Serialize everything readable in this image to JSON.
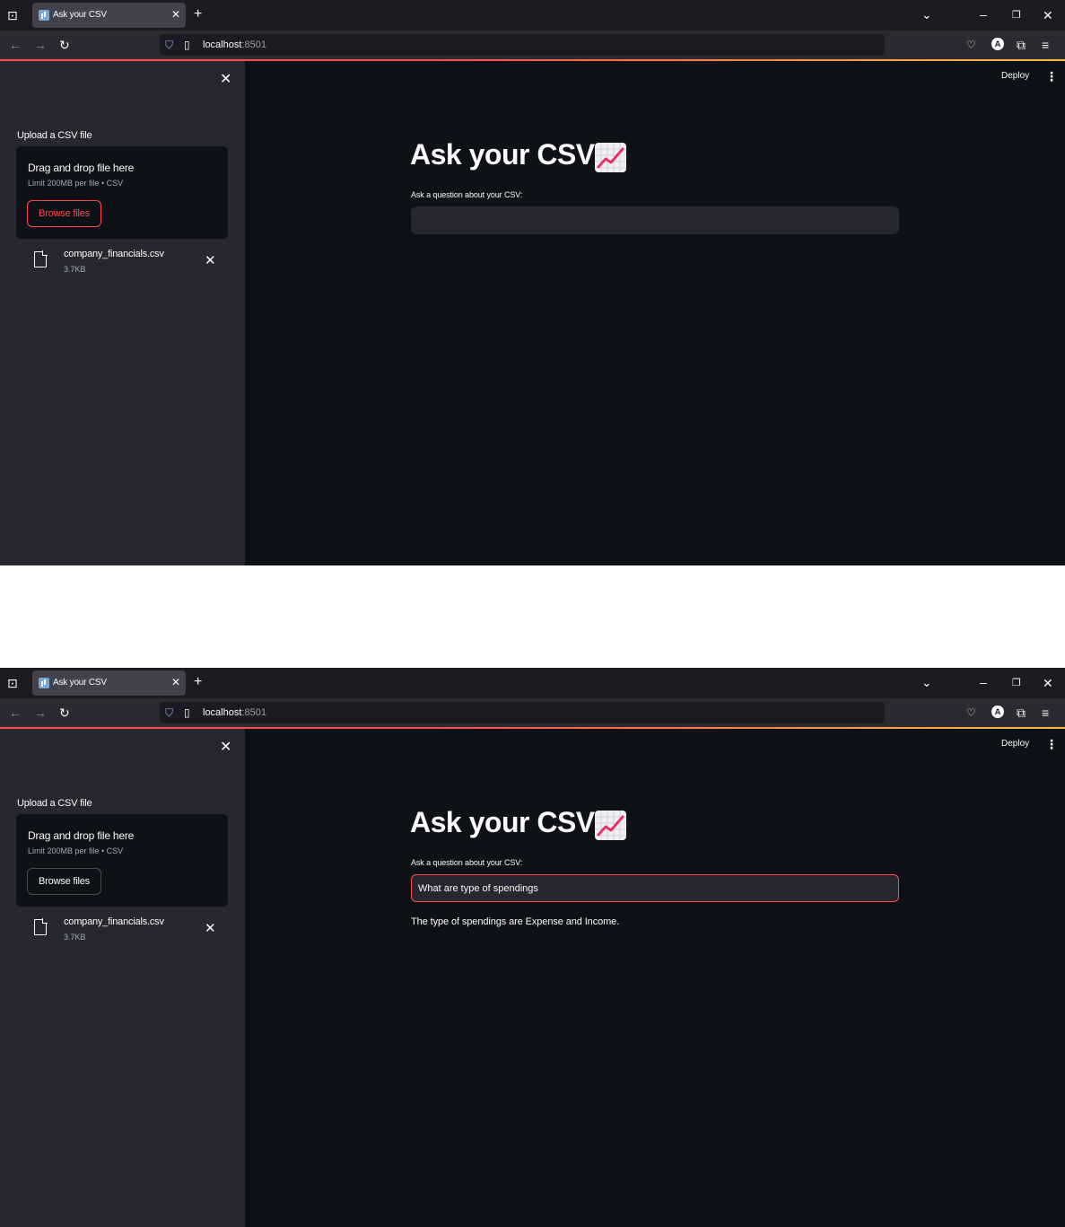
{
  "browser": {
    "tab_title": "Ask your CSV",
    "url_host": "localhost",
    "url_port": ":8501"
  },
  "sidebar": {
    "upload_label": "Upload a CSV file",
    "dropzone_title": "Drag and drop file here",
    "dropzone_limit": "Limit 200MB per file • CSV",
    "browse_label": "Browse files",
    "file_name": "company_financials.csv",
    "file_size": "3.7KB"
  },
  "header": {
    "deploy_label": "Deploy"
  },
  "main": {
    "title": "Ask your CSV",
    "title_emoji": "chart-increasing-icon",
    "question_label": "Ask a question about your CSV:",
    "question_value_1": "",
    "question_value_2": "What are type of spendings",
    "answer": "The type of spendings are Expense and Income."
  },
  "colors": {
    "accent": "#ff4b4b",
    "background": "#0e1117",
    "sidebar": "#262730"
  }
}
